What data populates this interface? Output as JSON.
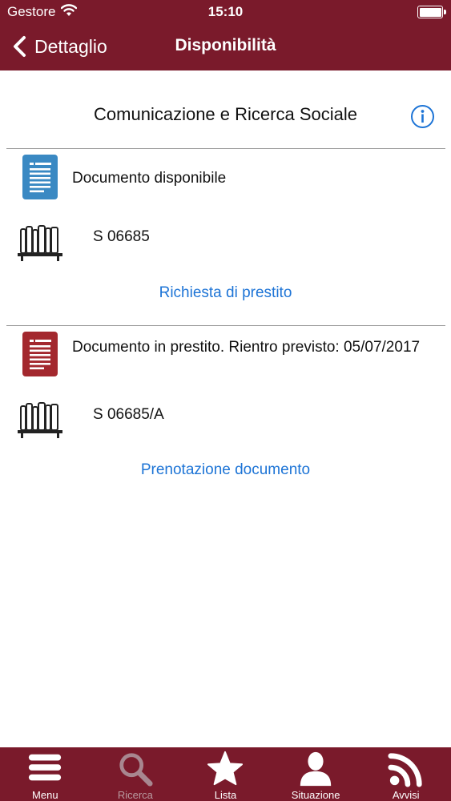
{
  "status_bar": {
    "carrier": "Gestore",
    "time": "15:10"
  },
  "nav": {
    "back_label": "Dettaglio",
    "title": "Disponibilità"
  },
  "heading": {
    "title": "Comunicazione e Ricerca Sociale"
  },
  "items": [
    {
      "status": "Documento disponibile",
      "call_number": "S 06685",
      "action": "Richiesta di prestito",
      "status_color": "#3a89c3"
    },
    {
      "status": "Documento in prestito. Rientro previsto: 05/07/2017",
      "call_number": "S 06685/A",
      "action": "Prenotazione documento",
      "status_color": "#a3282e"
    }
  ],
  "tabs": [
    {
      "label": "Menu",
      "icon": "menu-icon",
      "enabled": true
    },
    {
      "label": "Ricerca",
      "icon": "search-icon",
      "enabled": false
    },
    {
      "label": "Lista",
      "icon": "star-icon",
      "enabled": true
    },
    {
      "label": "Situazione",
      "icon": "user-icon",
      "enabled": true
    },
    {
      "label": "Avvisi",
      "icon": "rss-icon",
      "enabled": true
    }
  ],
  "colors": {
    "bar": "#7a1a2b",
    "link": "#1d74d6",
    "available": "#3a89c3",
    "on_loan": "#a3282e"
  }
}
